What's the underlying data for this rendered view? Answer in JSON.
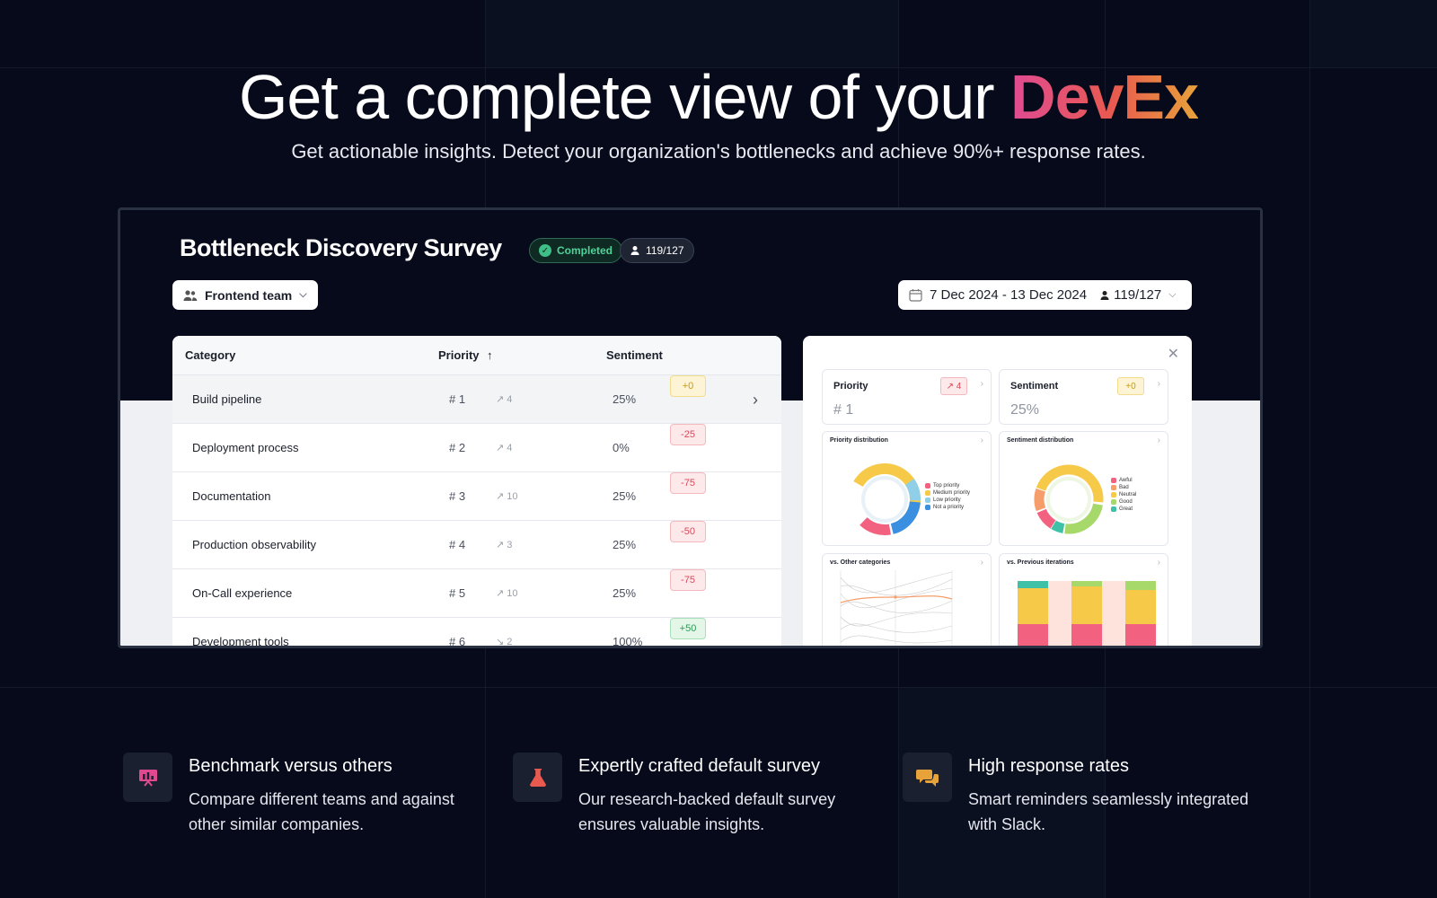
{
  "hero": {
    "title_prefix": "Get a complete view of your ",
    "title_accent": "DevEx",
    "subtitle": "Get actionable insights. Detect your organization's bottlenecks and achieve 90%+ response rates."
  },
  "survey": {
    "title": "Bottleneck Discovery Survey",
    "status": "Completed",
    "responses": "119/127"
  },
  "filters": {
    "team": "Frontend team",
    "date_range": "7 Dec 2024 - 13 Dec 2024",
    "responses": "119/127"
  },
  "table": {
    "headers": {
      "category": "Category",
      "priority": "Priority",
      "sentiment": "Sentiment"
    },
    "rows": [
      {
        "category": "Build pipeline",
        "rank": "# 1",
        "trend": "↗ 4",
        "pct": "25%",
        "delta": "+0",
        "tone": "pos0"
      },
      {
        "category": "Deployment process",
        "rank": "# 2",
        "trend": "↗ 4",
        "pct": "0%",
        "delta": "-25",
        "tone": "neg"
      },
      {
        "category": "Documentation",
        "rank": "# 3",
        "trend": "↗ 10",
        "pct": "25%",
        "delta": "-75",
        "tone": "neg"
      },
      {
        "category": "Production observability",
        "rank": "# 4",
        "trend": "↗ 3",
        "pct": "25%",
        "delta": "-50",
        "tone": "neg"
      },
      {
        "category": "On-Call experience",
        "rank": "# 5",
        "trend": "↗ 10",
        "pct": "25%",
        "delta": "-75",
        "tone": "neg"
      },
      {
        "category": "Development tools",
        "rank": "# 6",
        "trend": "↘ 2",
        "pct": "100%",
        "delta": "+50",
        "tone": "pos"
      }
    ]
  },
  "panel": {
    "priority": {
      "label": "Priority",
      "value": "# 1",
      "tag": "↗ 4"
    },
    "sentiment": {
      "label": "Sentiment",
      "value": "25%",
      "tag": "+0"
    },
    "priority_distribution": {
      "title": "Priority distribution",
      "legend": [
        "Top priority",
        "Medium priority",
        "Low priority",
        "Not a priority"
      ],
      "colors": [
        "#f2617f",
        "#f7c948",
        "#8fd0e8",
        "#3b8fe0"
      ]
    },
    "sentiment_distribution": {
      "title": "Sentiment distribution",
      "legend": [
        "Awful",
        "Bad",
        "Neutral",
        "Good",
        "Great"
      ],
      "colors": [
        "#f2617f",
        "#f59e6b",
        "#f7c948",
        "#a6d96a",
        "#3fc1a8"
      ]
    },
    "vs_other": {
      "title": "vs. Other categories"
    },
    "vs_previous": {
      "title": "vs. Previous iterations"
    }
  },
  "features": [
    {
      "icon": "presentation-chart-icon",
      "title": "Benchmark versus others",
      "desc": "Compare different teams and against other similar companies."
    },
    {
      "icon": "flask-icon",
      "title": "Expertly crafted default survey",
      "desc": "Our research-backed default survey ensures valuable insights."
    },
    {
      "icon": "chat-bubbles-icon",
      "title": "High response rates",
      "desc": "Smart reminders seamlessly integrated with Slack."
    }
  ]
}
